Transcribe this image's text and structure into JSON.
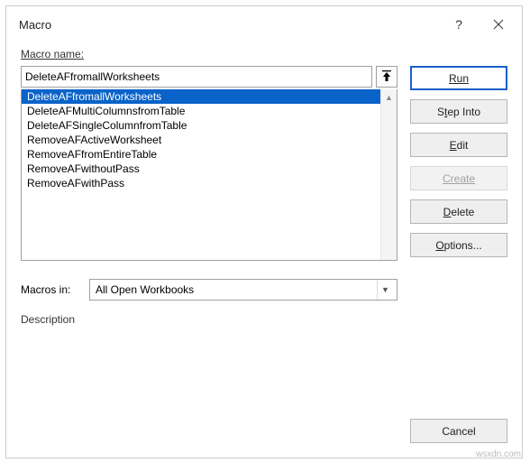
{
  "title": "Macro",
  "labels": {
    "name": "Macro name:",
    "macros_in": "Macros in:",
    "description": "Description"
  },
  "name_input": "DeleteAFfromallWorksheets",
  "list": [
    "DeleteAFfromallWorksheets",
    "DeleteAFMultiColumnsfromTable",
    "DeleteAFSingleColumnfromTable",
    "RemoveAFActiveWorksheet",
    "RemoveAFfromEntireTable",
    "RemoveAFwithoutPass",
    "RemoveAFwithPass"
  ],
  "selected_index": 0,
  "macros_in_value": "All Open Workbooks",
  "buttons": {
    "run": "Run",
    "step_into_pre": "S",
    "step_into_u": "t",
    "step_into_post": "ep Into",
    "edit_u": "E",
    "edit_post": "dit",
    "create": "Create",
    "delete_u": "D",
    "delete_post": "elete",
    "options_u": "O",
    "options_post": "ptions...",
    "cancel": "Cancel"
  },
  "watermark": "wsxdn.com"
}
